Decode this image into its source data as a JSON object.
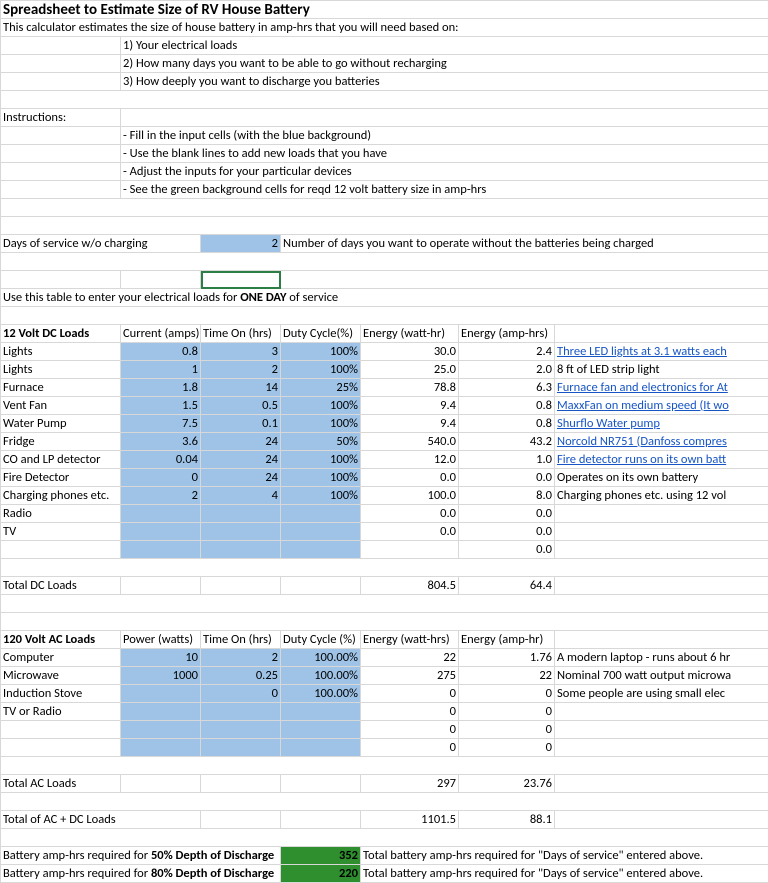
{
  "title": "Spreadsheet to Estimate Size of RV House Battery",
  "intro": "This calculator estimates the size of house battery in amp-hrs that you will need based on:",
  "intro_pts": [
    "1) Your electrical loads",
    "2) How many days you want to be able to go without recharging",
    "3) How deeply you want to discharge you batteries"
  ],
  "instr_label": "Instructions:",
  "instr_pts": [
    "- Fill in the input cells (with the blue background)",
    "- Use the blank lines to add new loads that you have",
    "- Adjust the inputs for your particular devices",
    "- See the green background cells for reqd 12 volt battery size in amp-hrs"
  ],
  "days_label": "Days of service w/o charging",
  "days_value": "2",
  "days_note": "Number of days you want to operate without the batteries being charged",
  "table_intro_pre": "Use this table to enter your electrical loads for ",
  "table_intro_bold": "ONE DAY",
  "table_intro_post": " of service",
  "dc": {
    "section": "12 Volt DC Loads",
    "h": {
      "cur": "Current (amps)",
      "time": "Time On (hrs)",
      "duty": "Duty Cycle(%)",
      "ewh": "Energy (watt-hr)",
      "eah": "Energy (amp-hrs)"
    },
    "rows": [
      {
        "name": "Lights",
        "cur": "0.8",
        "time": "3",
        "duty": "100%",
        "ewh": "30.0",
        "eah": "2.4",
        "note": "Three LED lights at 3.1 watts each",
        "link": true
      },
      {
        "name": "Lights",
        "cur": "1",
        "time": "2",
        "duty": "100%",
        "ewh": "25.0",
        "eah": "2.0",
        "note": "8 ft of LED strip light",
        "link": false
      },
      {
        "name": "Furnace",
        "cur": "1.8",
        "time": "14",
        "duty": "25%",
        "ewh": "78.8",
        "eah": "6.3",
        "note": "Furnace fan and electronics for At",
        "link": true
      },
      {
        "name": "Vent Fan",
        "cur": "1.5",
        "time": "0.5",
        "duty": "100%",
        "ewh": "9.4",
        "eah": "0.8",
        "note": "MaxxFan on medium speed (It wo",
        "link": true
      },
      {
        "name": "Water Pump",
        "cur": "7.5",
        "time": "0.1",
        "duty": "100%",
        "ewh": "9.4",
        "eah": "0.8",
        "note": "Shurflo Water pump",
        "link": true
      },
      {
        "name": "Fridge",
        "cur": "3.6",
        "time": "24",
        "duty": "50%",
        "ewh": "540.0",
        "eah": "43.2",
        "note": "Norcold NR751 (Danfoss compres",
        "link": true
      },
      {
        "name": "CO and LP detector",
        "cur": "0.04",
        "time": "24",
        "duty": "100%",
        "ewh": "12.0",
        "eah": "1.0",
        "note": "Fire detector runs on its own batt",
        "link": true
      },
      {
        "name": "Fire Detector",
        "cur": "0",
        "time": "24",
        "duty": "100%",
        "ewh": "0.0",
        "eah": "0.0",
        "note": "Operates on its own battery",
        "link": false
      },
      {
        "name": "Charging phones etc.",
        "cur": "2",
        "time": "4",
        "duty": "100%",
        "ewh": "100.0",
        "eah": "8.0",
        "note": "Charging phones etc. using 12 vol",
        "link": false
      },
      {
        "name": "Radio",
        "cur": "",
        "time": "",
        "duty": "",
        "ewh": "0.0",
        "eah": "0.0",
        "note": "",
        "link": false
      },
      {
        "name": "TV",
        "cur": "",
        "time": "",
        "duty": "",
        "ewh": "0.0",
        "eah": "0.0",
        "note": "",
        "link": false
      },
      {
        "name": "",
        "cur": "",
        "time": "",
        "duty": "",
        "ewh": "",
        "eah": "0.0",
        "note": "",
        "link": false
      }
    ],
    "total": {
      "label": "Total DC Loads",
      "ewh": "804.5",
      "eah": "64.4"
    }
  },
  "ac": {
    "section": "120 Volt AC Loads",
    "h": {
      "pow": "Power (watts)",
      "time": "Time On (hrs)",
      "duty": "Duty Cycle (%)",
      "ewh": "Energy (watt-hrs)",
      "eah": "Energy (amp-hr)"
    },
    "rows": [
      {
        "name": "Computer",
        "pow": "10",
        "time": "2",
        "duty": "100.00%",
        "ewh": "22",
        "eah": "1.76",
        "note": "A modern laptop - runs about 6 hr"
      },
      {
        "name": "Microwave",
        "pow": "1000",
        "time": "0.25",
        "duty": "100.00%",
        "ewh": "275",
        "eah": "22",
        "note": "Nominal 700 watt output microwa"
      },
      {
        "name": "Induction Stove",
        "pow": "",
        "time": "0",
        "duty": "100.00%",
        "ewh": "0",
        "eah": "0",
        "note": "Some people are using small elec"
      },
      {
        "name": "TV or Radio",
        "pow": "",
        "time": "",
        "duty": "",
        "ewh": "0",
        "eah": "0",
        "note": ""
      },
      {
        "name": "",
        "pow": "",
        "time": "",
        "duty": "",
        "ewh": "0",
        "eah": "0",
        "note": ""
      },
      {
        "name": "",
        "pow": "",
        "time": "",
        "duty": "",
        "ewh": "0",
        "eah": "0",
        "note": ""
      }
    ],
    "total": {
      "label": "Total AC Loads",
      "ewh": "297",
      "eah": "23.76"
    }
  },
  "grand": {
    "label": "Total of AC + DC Loads",
    "ewh": "1101.5",
    "eah": "88.1"
  },
  "dod": {
    "r50_pre": "Battery amp-hrs required for ",
    "r50_b": "50% Depth of Discharge",
    "r50_val": "352",
    "r80_pre": "Battery amp-hrs required for ",
    "r80_b": "80% Depth of Discharge",
    "r80_val": "220",
    "note": "Total battery amp-hrs required for \"Days of service\" entered above."
  },
  "chart_data": {
    "type": "table",
    "title": "RV House Battery Sizing Worksheet",
    "inputs": {
      "days_of_service": 2
    },
    "dc_loads": {
      "columns": [
        "Name",
        "Current (amps)",
        "Time On (hrs)",
        "Duty Cycle (%)",
        "Energy (watt-hr)",
        "Energy (amp-hrs)",
        "Note"
      ],
      "rows": [
        [
          "Lights",
          0.8,
          3,
          100,
          30.0,
          2.4,
          "Three LED lights at 3.1 watts each"
        ],
        [
          "Lights",
          1,
          2,
          100,
          25.0,
          2.0,
          "8 ft of LED strip light"
        ],
        [
          "Furnace",
          1.8,
          14,
          25,
          78.8,
          6.3,
          "Furnace fan and electronics"
        ],
        [
          "Vent Fan",
          1.5,
          0.5,
          100,
          9.4,
          0.8,
          "MaxxFan on medium speed"
        ],
        [
          "Water Pump",
          7.5,
          0.1,
          100,
          9.4,
          0.8,
          "Shurflo Water pump"
        ],
        [
          "Fridge",
          3.6,
          24,
          50,
          540.0,
          43.2,
          "Norcold NR751 (Danfoss compressor)"
        ],
        [
          "CO and LP detector",
          0.04,
          24,
          100,
          12.0,
          1.0,
          "Fire detector runs on its own battery"
        ],
        [
          "Fire Detector",
          0,
          24,
          100,
          0.0,
          0.0,
          "Operates on its own battery"
        ],
        [
          "Charging phones etc.",
          2,
          4,
          100,
          100.0,
          8.0,
          "Charging phones etc. using 12 volt"
        ],
        [
          "Radio",
          null,
          null,
          null,
          0.0,
          0.0,
          ""
        ],
        [
          "TV",
          null,
          null,
          null,
          0.0,
          0.0,
          ""
        ]
      ],
      "totals": {
        "energy_watt_hr": 804.5,
        "energy_amp_hr": 64.4
      }
    },
    "ac_loads": {
      "columns": [
        "Name",
        "Power (watts)",
        "Time On (hrs)",
        "Duty Cycle (%)",
        "Energy (watt-hrs)",
        "Energy (amp-hr)",
        "Note"
      ],
      "rows": [
        [
          "Computer",
          10,
          2,
          100,
          22,
          1.76,
          "A modern laptop"
        ],
        [
          "Microwave",
          1000,
          0.25,
          100,
          275,
          22,
          "Nominal 700 watt output microwave"
        ],
        [
          "Induction Stove",
          null,
          0,
          100,
          0,
          0,
          "Some people are using small electric"
        ],
        [
          "TV or Radio",
          null,
          null,
          null,
          0,
          0,
          ""
        ]
      ],
      "totals": {
        "energy_watt_hr": 297,
        "energy_amp_hr": 23.76
      }
    },
    "combined_total": {
      "energy_watt_hr": 1101.5,
      "energy_amp_hr": 88.1
    },
    "battery_required_amp_hr": {
      "dod_50pct": 352,
      "dod_80pct": 220
    }
  }
}
